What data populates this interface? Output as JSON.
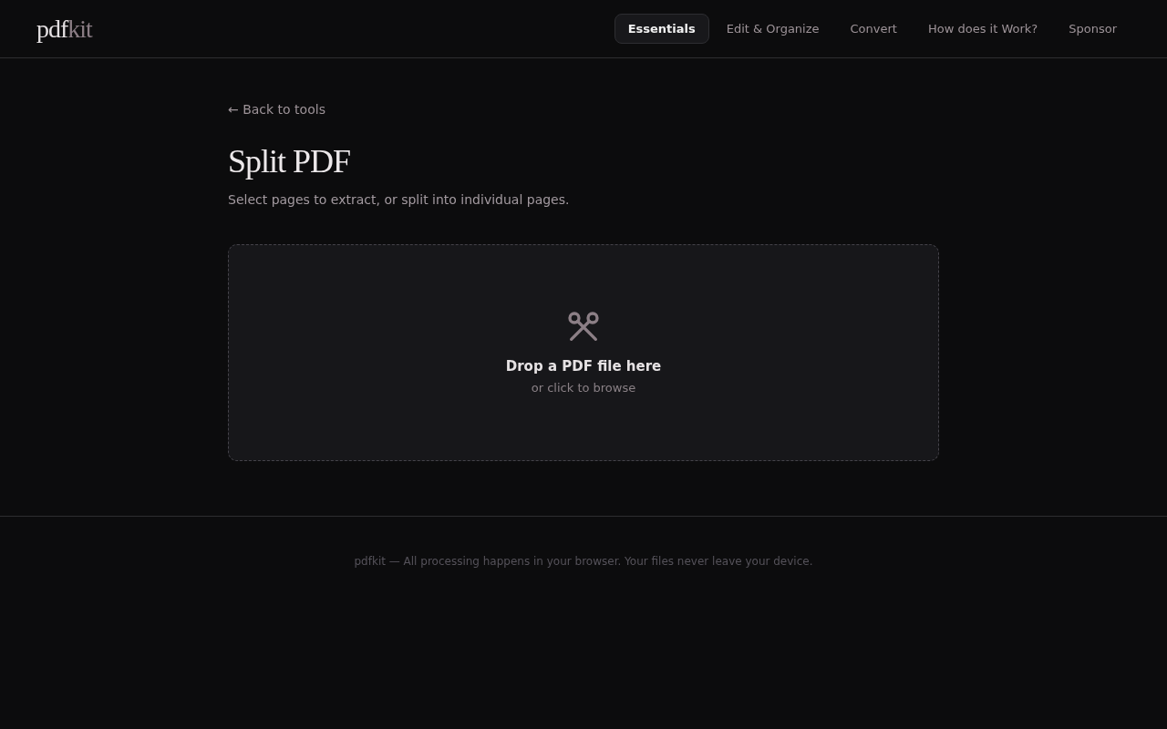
{
  "logo": {
    "main": "pdf",
    "accent": "kit"
  },
  "nav": [
    {
      "label": "Essentials",
      "selected": true
    },
    {
      "label": "Edit & Organize",
      "selected": false
    },
    {
      "label": "Convert",
      "selected": false
    },
    {
      "label": "How does it Work?",
      "selected": false
    },
    {
      "label": "Sponsor",
      "selected": false
    }
  ],
  "back_link": "← Back to tools",
  "title": "Split PDF",
  "subtitle": "Select pages to extract, or split into individual pages.",
  "dropzone": {
    "title": "Drop a PDF file here",
    "hint": "or click to browse"
  },
  "footer": "pdfkit — All processing happens in your browser. Your files never leave your device."
}
